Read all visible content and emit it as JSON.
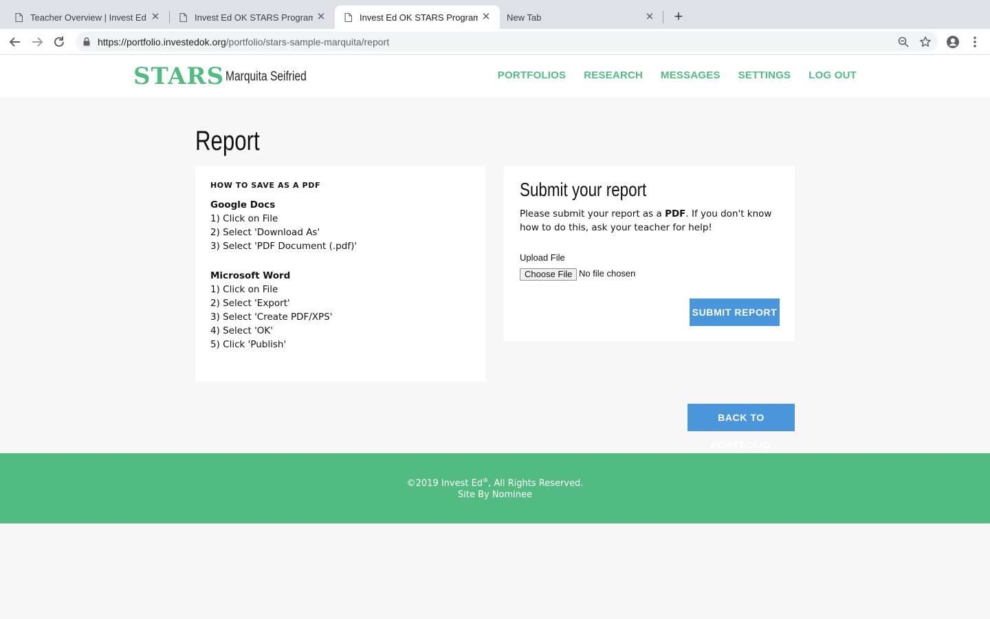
{
  "browser": {
    "tabs": [
      {
        "title": "Teacher Overview | Invest Ed",
        "active": false
      },
      {
        "title": "Invest Ed OK STARS Program",
        "active": false
      },
      {
        "title": "Invest Ed OK STARS Program",
        "active": true
      },
      {
        "title": "New Tab",
        "active": false
      }
    ],
    "url_host": "https://portfolio.investedok.org",
    "url_path": "/portfolio/stars-sample-marquita/report"
  },
  "header": {
    "logo": "STARS",
    "student_name": "Marquita Seifried",
    "nav": [
      "PORTFOLIOS",
      "RESEARCH",
      "MESSAGES",
      "SETTINGS",
      "LOG OUT"
    ]
  },
  "main": {
    "title": "Report",
    "howto": {
      "heading": "HOW TO SAVE AS A PDF",
      "google": {
        "title": "Google Docs",
        "steps": [
          "1) Click on File",
          "2) Select 'Download As'",
          "3) Select 'PDF Document (.pdf)'"
        ]
      },
      "word": {
        "title": "Microsoft Word",
        "steps": [
          "1) Click on File",
          "2) Select 'Export'",
          "3) Select 'Create PDF/XPS'",
          "4) Select 'OK'",
          "5) Click 'Publish'"
        ]
      }
    },
    "submit": {
      "title": "Submit your report",
      "text_before": "Please submit your report as a ",
      "text_bold": "PDF",
      "text_after": ". If you don't know how to do this, ask your teacher for help!",
      "upload_label": "Upload File",
      "choose_button": "Choose File",
      "no_file": "No file chosen",
      "submit_button": "SUBMIT REPORT"
    },
    "back_button": "BACK TO PORTFOLIO"
  },
  "footer": {
    "copyright": "©2019 Invest Ed",
    "registered": "®",
    "rights": ", All Rights Reserved.",
    "site_by": "Site By Nominee"
  },
  "colors": {
    "brand_green": "#52bb82",
    "button_blue": "#4a96db",
    "page_bg": "#f7f7f7"
  }
}
